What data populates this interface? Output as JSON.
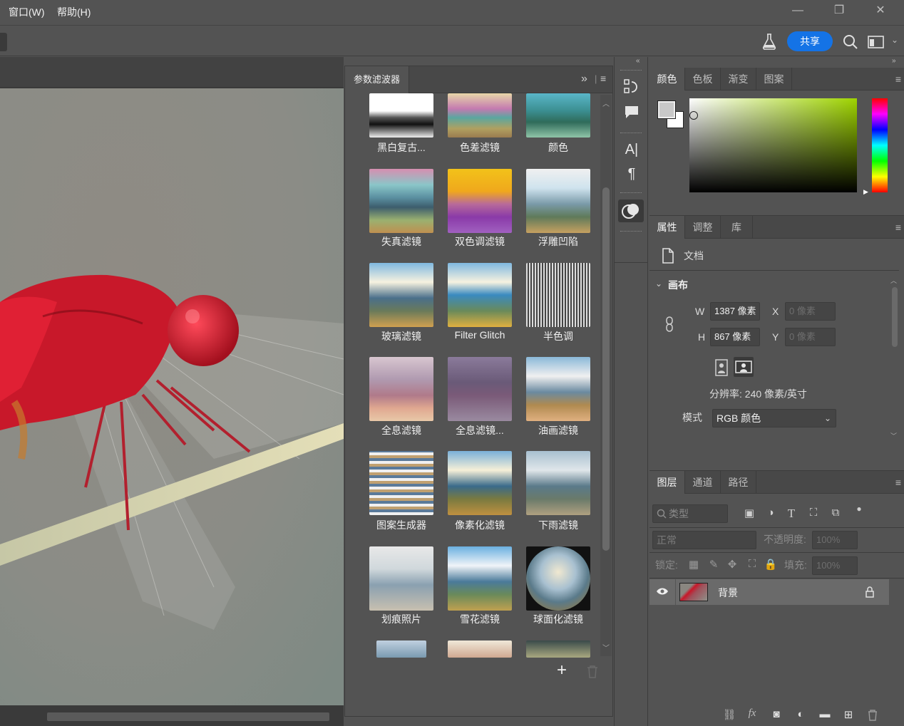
{
  "menu": {
    "window": "窗口(W)",
    "help": "帮助(H)"
  },
  "window_controls": {
    "minimize": "—",
    "restore": "❐",
    "close": "✕"
  },
  "options_bar": {
    "share_label": "共享"
  },
  "filter_panel": {
    "title": "参数滤波器",
    "collapse_glyph": "»",
    "filters": [
      "黑白复古...",
      "色差滤镜",
      "颜色",
      "失真滤镜",
      "双色调滤镜",
      "浮雕凹陷",
      "玻璃滤镜",
      "Filter Glitch",
      "半色调",
      "全息滤镜",
      "全息滤镜...",
      "油画滤镜",
      "图案生成器",
      "像素化滤镜",
      "下雨滤镜",
      "划痕照片",
      "雪花滤镜",
      "球面化滤镜"
    ],
    "add_glyph": "+",
    "delete_glyph": "🗑"
  },
  "tools": {
    "icons": [
      "history-icon",
      "comment-icon",
      "character-icon",
      "paragraph-icon",
      "swatch-filter-icon"
    ],
    "char_glyph": "A|",
    "para_glyph": "¶"
  },
  "color_panel": {
    "tabs": [
      "颜色",
      "色板",
      "渐变",
      "图案"
    ],
    "foreground": "#c8c8c8",
    "background": "#ffffff",
    "hue_color": "#9fd400"
  },
  "properties_panel": {
    "tabs": [
      "属性",
      "调整",
      "库"
    ],
    "doc_label": "文档",
    "section": "画布",
    "w_label": "W",
    "w_value": "1387 像素",
    "h_label": "H",
    "h_value": "867 像素",
    "x_label": "X",
    "x_value": "0 像素",
    "y_label": "Y",
    "y_value": "0 像素",
    "resolution": "分辨率: 240 像素/英寸",
    "mode_label": "模式",
    "mode_value": "RGB 颜色"
  },
  "layers_panel": {
    "tabs": [
      "图层",
      "通道",
      "路径"
    ],
    "filter_kind": "类型",
    "blend_mode": "正常",
    "opacity_label": "不透明度:",
    "opacity_value": "100%",
    "lock_label": "锁定:",
    "fill_label": "填充:",
    "fill_value": "100%",
    "layer_name": "背景",
    "bottom_fx": "fx"
  }
}
